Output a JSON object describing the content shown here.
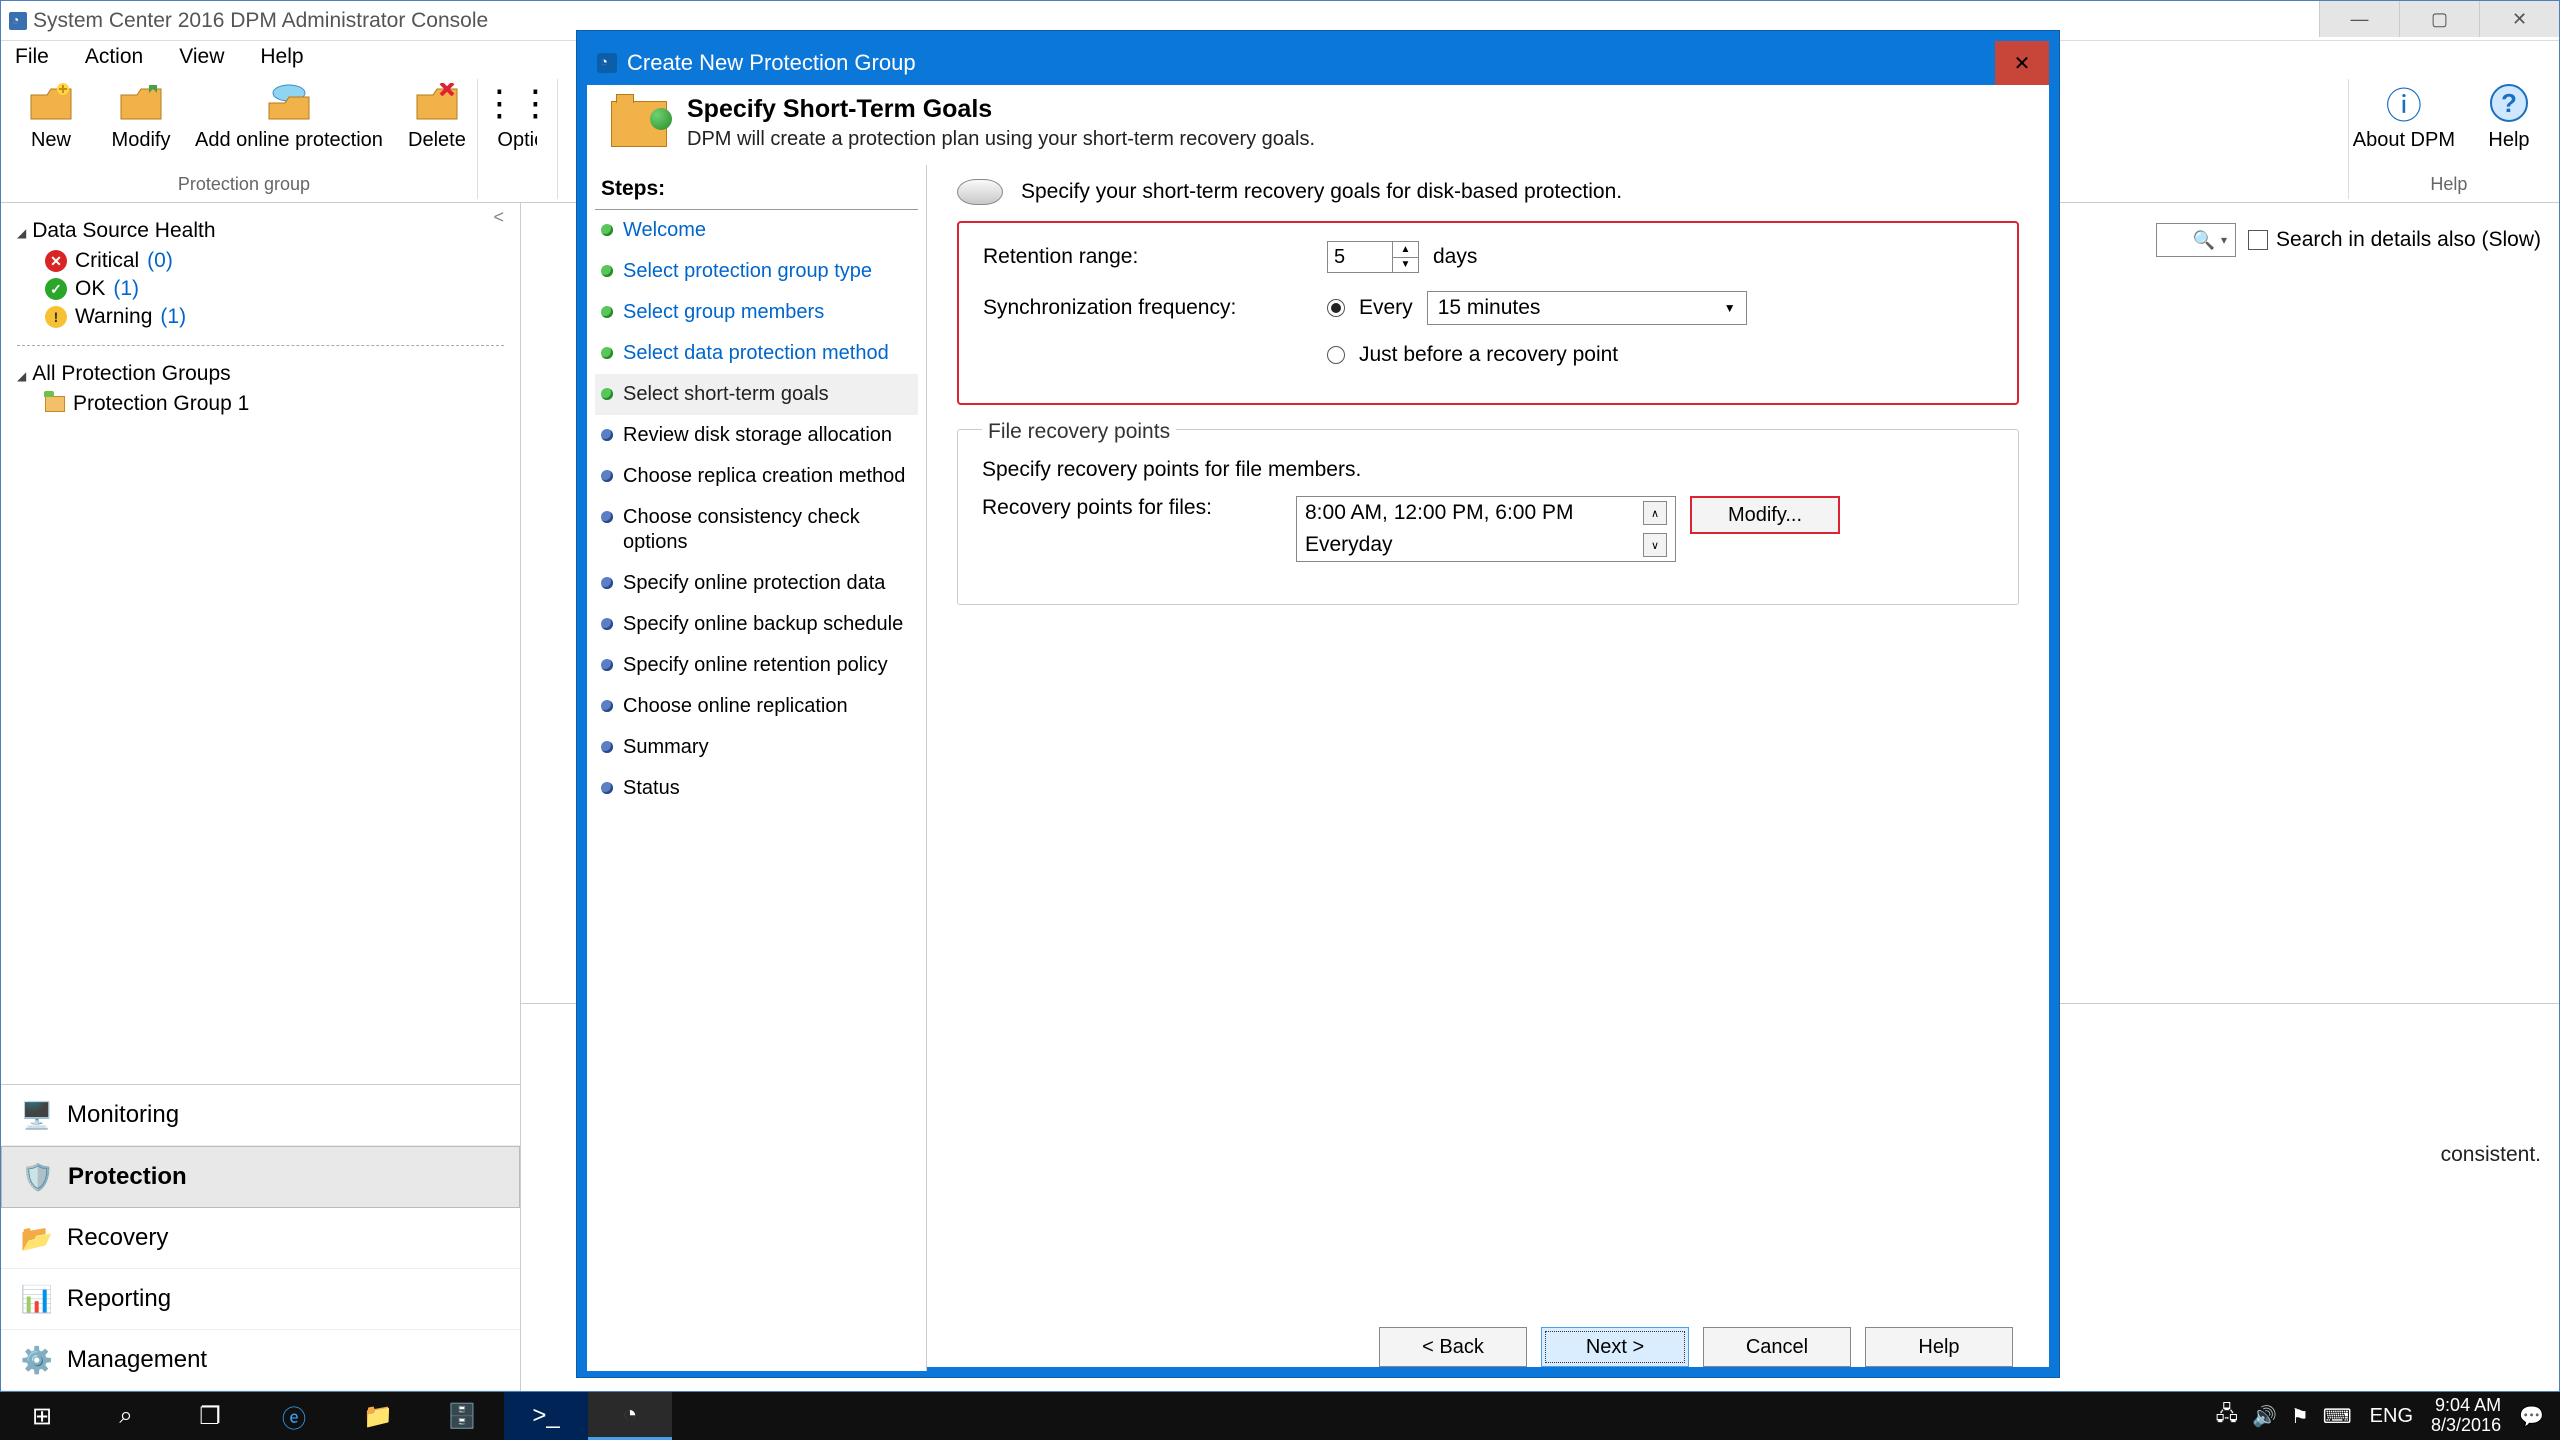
{
  "window": {
    "title": "System Center 2016 DPM Administrator Console"
  },
  "menubar": [
    "File",
    "Action",
    "View",
    "Help"
  ],
  "toolbar": {
    "group1_label": "Protection group",
    "new": "New",
    "modify": "Modify",
    "add_online": "Add online protection",
    "delete": "Delete",
    "options": "Options",
    "about": "About DPM",
    "help": "Help",
    "group_help_label": "Help"
  },
  "left_nav": {
    "health_title": "Data Source Health",
    "critical_label": "Critical",
    "critical_count": "(0)",
    "ok_label": "OK",
    "ok_count": "(1)",
    "warning_label": "Warning",
    "warning_count": "(1)",
    "groups_title": "All Protection Groups",
    "group1": "Protection Group 1",
    "nav_monitoring": "Monitoring",
    "nav_protection": "Protection",
    "nav_recovery": "Recovery",
    "nav_reporting": "Reporting",
    "nav_management": "Management"
  },
  "content": {
    "search_details_label": "Search in details also (Slow)",
    "trail_text": "consistent."
  },
  "dialog": {
    "title": "Create New Protection Group",
    "header_title": "Specify Short-Term Goals",
    "header_sub": "DPM will create a protection plan using your short-term recovery goals.",
    "steps_header": "Steps:",
    "steps": [
      {
        "label": "Welcome",
        "state": "done",
        "link": true
      },
      {
        "label": "Select protection group type",
        "state": "done",
        "link": true
      },
      {
        "label": "Select group members",
        "state": "done",
        "link": true
      },
      {
        "label": "Select data protection method",
        "state": "done",
        "link": true
      },
      {
        "label": "Select short-term goals",
        "state": "done",
        "link": false,
        "current": true
      },
      {
        "label": "Review disk storage allocation",
        "state": "pending"
      },
      {
        "label": "Choose replica creation method",
        "state": "pending"
      },
      {
        "label": "Choose consistency check options",
        "state": "pending"
      },
      {
        "label": "Specify online protection data",
        "state": "pending"
      },
      {
        "label": "Specify online backup schedule",
        "state": "pending"
      },
      {
        "label": "Specify online retention policy",
        "state": "pending"
      },
      {
        "label": "Choose online replication",
        "state": "pending"
      },
      {
        "label": "Summary",
        "state": "pending"
      },
      {
        "label": "Status",
        "state": "pending"
      }
    ],
    "instruction": "Specify your short-term recovery goals for disk-based protection.",
    "retention_label": "Retention range:",
    "retention_value": "5",
    "retention_unit": "days",
    "sync_label": "Synchronization frequency:",
    "sync_every": "Every",
    "sync_interval": "15 minutes",
    "sync_just_before": "Just before a recovery point",
    "frp_legend": "File recovery points",
    "frp_instruction": "Specify recovery points for file members.",
    "frp_label": "Recovery points for files:",
    "frp_times": "8:00 AM, 12:00 PM, 6:00 PM",
    "frp_days": "Everyday",
    "modify_btn": "Modify...",
    "back_btn": "< Back",
    "next_btn": "Next >",
    "cancel_btn": "Cancel",
    "help_btn": "Help"
  },
  "taskbar": {
    "lang": "ENG",
    "time": "9:04 AM",
    "date": "8/3/2016"
  }
}
